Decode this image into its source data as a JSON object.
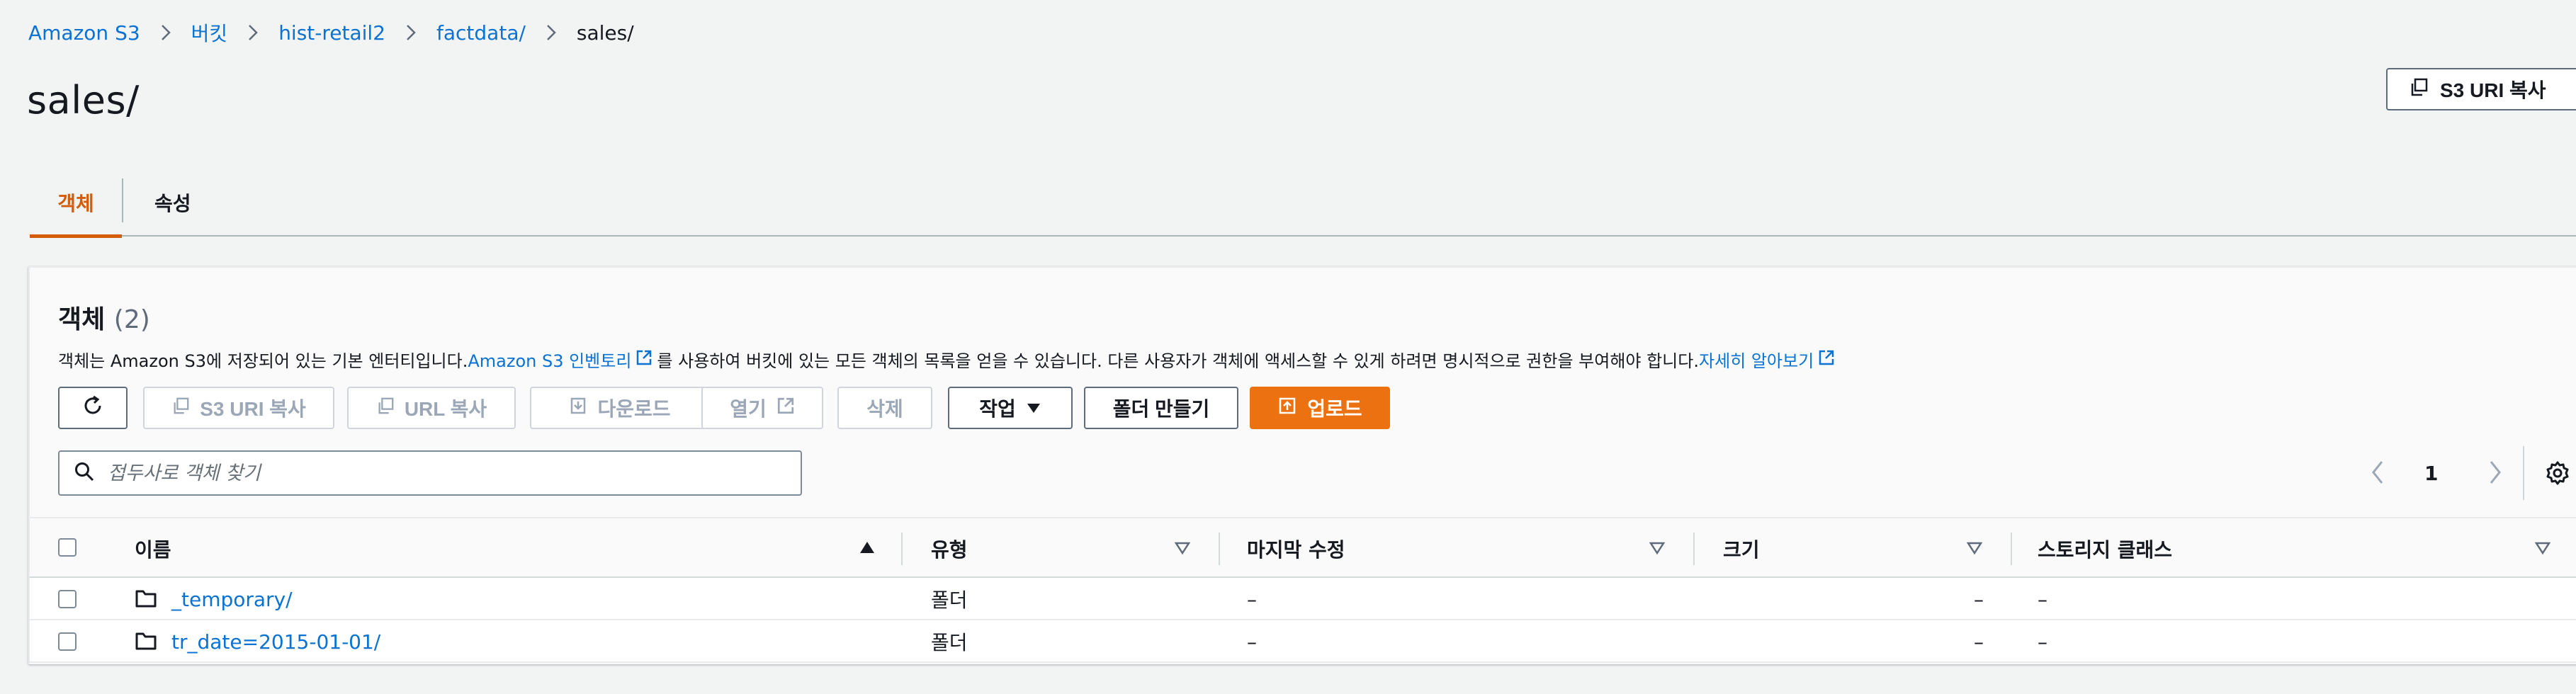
{
  "breadcrumb": {
    "items": [
      "Amazon S3",
      "버킷",
      "hist-retail2",
      "factdata/"
    ],
    "current": "sales/"
  },
  "page": {
    "title": "sales/",
    "copy_uri_label": "S3 URI 복사"
  },
  "tabs": [
    {
      "label": "객체",
      "active": true
    },
    {
      "label": "속성",
      "active": false
    }
  ],
  "objects_panel": {
    "heading": "객체",
    "count": "(2)",
    "desc_part1": "객체는 Amazon S3에 저장되어 있는 기본 엔터티입니다. ",
    "inventory_link": "Amazon S3 인벤토리",
    "desc_part2": "를 사용하여 버킷에 있는 모든 객체의 목록을 얻을 수 있습니다. 다른 사용자가 객체에 액세스할 수 있게 하려면 명시적으로 권한을 부여해야 합니다. ",
    "learn_more_link": "자세히 알아보기"
  },
  "actions": {
    "copy_s3_uri": "S3 URI 복사",
    "copy_url": "URL 복사",
    "download": "다운로드",
    "open": "열기",
    "delete": "삭제",
    "actions_menu": "작업",
    "create_folder": "폴더 만들기",
    "upload": "업로드"
  },
  "search": {
    "placeholder": "접두사로 객체 찾기",
    "value": ""
  },
  "pagination": {
    "current_page": "1"
  },
  "table": {
    "columns": [
      "이름",
      "유형",
      "마지막 수정",
      "크기",
      "스토리지 클래스"
    ],
    "rows": [
      {
        "name": "_temporary/",
        "type": "폴더",
        "modified": "–",
        "size": "–",
        "storage_class": "–"
      },
      {
        "name": "tr_date=2015-01-01/",
        "type": "폴더",
        "modified": "–",
        "size": "–",
        "storage_class": "–"
      }
    ]
  },
  "colors": {
    "accent": "#ec7211",
    "link": "#0972d3",
    "active_tab": "#d45b07"
  }
}
